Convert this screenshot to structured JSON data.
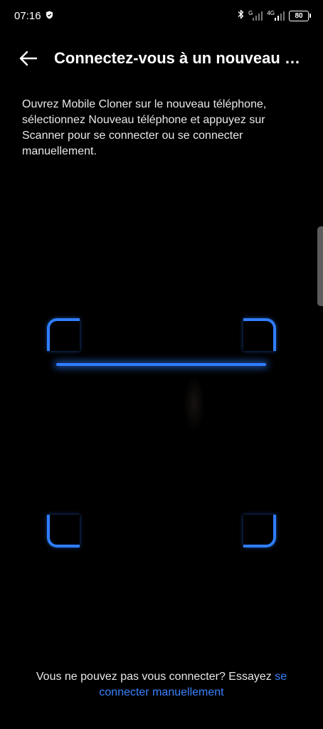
{
  "status_bar": {
    "time": "07:16",
    "network_g": "G",
    "network_4g": "4G",
    "battery": "80",
    "icons": [
      "shield-icon",
      "bluetooth-icon",
      "signal-icon",
      "signal-icon",
      "battery-icon"
    ]
  },
  "header": {
    "title": "Connectez-vous à un nouveau téléphone",
    "back_icon": "arrow-left-icon"
  },
  "instructions": "Ouvrez Mobile Cloner sur le nouveau téléphone, sélectionnez Nouveau téléphone et appuyez sur Scanner pour se connecter ou se connecter manuellement.",
  "footer": {
    "prompt": "Vous ne pouvez pas vous connecter? Essayez ",
    "link": "se connecter manuellement"
  },
  "colors": {
    "background": "#000000",
    "accent": "#2f7dff",
    "link": "#3a82ff"
  }
}
